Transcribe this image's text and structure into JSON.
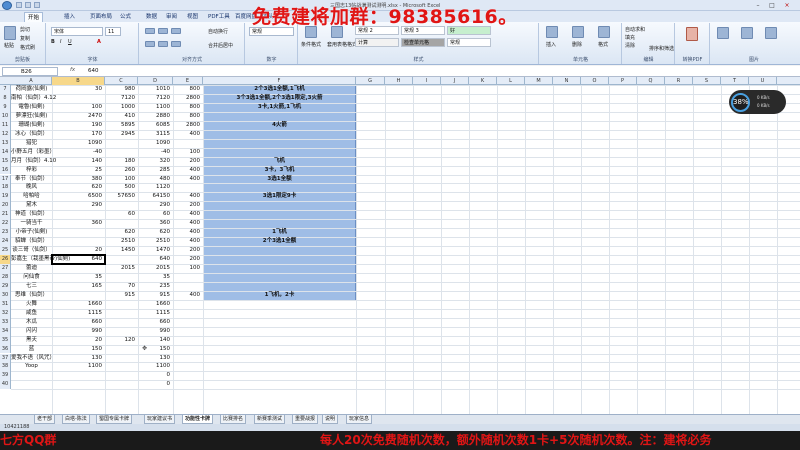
{
  "titlebar": {
    "title": "三国志13帖战满测试测明.xlsx - Microsoft Excel",
    "min": "–",
    "max": "□",
    "close": "×"
  },
  "tabs": [
    "开始",
    "插入",
    "页面布局",
    "公式",
    "数据",
    "审阅",
    "视图",
    "PDF工具",
    "百度网盘",
    "团队"
  ],
  "ribbon": {
    "clipboard": {
      "label": "剪贴板",
      "paste": "粘贴",
      "cut": "剪切",
      "copy": "复制",
      "format_painter": "格式刷"
    },
    "font": {
      "label": "字体",
      "name": "宋体",
      "size": "11"
    },
    "alignment": {
      "label": "对齐方式",
      "wrap": "自动换行",
      "merge": "合并后居中"
    },
    "number": {
      "label": "数字",
      "format": "常规"
    },
    "styles": {
      "label": "样式",
      "cond": "条件格式",
      "table": "套用表格格式",
      "cells": [
        {
          "text": "常规 2",
          "bg": "#ffffff"
        },
        {
          "text": "常规 3",
          "bg": "#ffffff"
        },
        {
          "text": "好",
          "bg": "#c6efce"
        },
        {
          "text": "计算",
          "bg": "#f2f2f2"
        },
        {
          "text": "检查单元格",
          "bg": "#a5a5a5"
        },
        {
          "text": "常规",
          "bg": "#ffffff"
        }
      ]
    },
    "cells": {
      "label": "单元格",
      "insert": "插入",
      "delete": "删除",
      "format": "格式"
    },
    "editing": {
      "label": "编辑",
      "autosum": "自动求和",
      "fill": "填充",
      "clear": "清除",
      "sort": "排序和筛选",
      "find": "查找和选择"
    },
    "pdf": {
      "label": "转换PDF"
    },
    "extra": {
      "label": "图片"
    }
  },
  "formula_bar": {
    "namebox": "B26",
    "fx": "fx",
    "value": "640"
  },
  "columns": [
    "A",
    "B",
    "C",
    "D",
    "E",
    "F",
    "G",
    "H",
    "I",
    "J",
    "K",
    "L",
    "M",
    "N",
    "O",
    "P",
    "Q",
    "R",
    "S",
    "T",
    "U"
  ],
  "rows": [
    {
      "n": "7",
      "a": "荷岡露(仙剣)",
      "b": "30",
      "c": "980",
      "d": "1010",
      "e": "800",
      "f": "2个3选1全额,1飞机"
    },
    {
      "n": "8",
      "a": "南帕（仙剑）4.12",
      "b": "",
      "c": "7120",
      "d": "7120",
      "e": "2800",
      "f": "3个3选1全额,2个3选1限定,3火箭"
    },
    {
      "n": "9",
      "a": "電魯(仙剣)",
      "b": "100",
      "c": "1000",
      "d": "1100",
      "e": "800",
      "f": "3卡,1火箭,1飞机"
    },
    {
      "n": "10",
      "a": "夢漂狂(仙剣)",
      "b": "2470",
      "c": "410",
      "d": "2880",
      "e": "800",
      "f": ""
    },
    {
      "n": "11",
      "a": "珊瑚(仙剣)",
      "b": "190",
      "c": "5895",
      "d": "6085",
      "e": "2800",
      "f": "4火箭"
    },
    {
      "n": "12",
      "a": "冰心（仙剑）",
      "b": "170",
      "c": "2945",
      "d": "3115",
      "e": "400",
      "f": ""
    },
    {
      "n": "13",
      "a": "猎犯",
      "b": "1090",
      "c": "",
      "d": "1090",
      "e": "",
      "f": ""
    },
    {
      "n": "14",
      "a": "小野五月（彩墨）",
      "b": "-40",
      "c": "",
      "d": "-40",
      "e": "100",
      "f": ""
    },
    {
      "n": "15",
      "a": "月月（仙剑）4.10",
      "b": "140",
      "c": "180",
      "d": "320",
      "e": "200",
      "f": "飞机"
    },
    {
      "n": "16",
      "a": "梓彩",
      "b": "25",
      "c": "260",
      "d": "285",
      "e": "400",
      "f": "3卡，3飞机"
    },
    {
      "n": "17",
      "a": "奉节（仙剑）",
      "b": "380",
      "c": "100",
      "d": "480",
      "e": "400",
      "f": "3选1全额"
    },
    {
      "n": "18",
      "a": "晚风",
      "b": "620",
      "c": "500",
      "d": "1120",
      "e": "",
      "f": ""
    },
    {
      "n": "19",
      "a": "哈帕哈",
      "b": "6500",
      "c": "57650",
      "d": "64150",
      "e": "400",
      "f": "3选1限定9卡"
    },
    {
      "n": "20",
      "a": "黛木",
      "b": "290",
      "c": "",
      "d": "290",
      "e": "200",
      "f": ""
    },
    {
      "n": "21",
      "a": "神道（仙剑）",
      "b": "",
      "c": "60",
      "d": "60",
      "e": "400",
      "f": ""
    },
    {
      "n": "22",
      "a": "一骑当千",
      "b": "360",
      "c": "",
      "d": "360",
      "e": "400",
      "f": ""
    },
    {
      "n": "23",
      "a": "小帝子(仙剣)",
      "b": "",
      "c": "620",
      "d": "620",
      "e": "400",
      "f": "1飞机"
    },
    {
      "n": "24",
      "a": "貂蝉（仙剑）",
      "b": "",
      "c": "2510",
      "d": "2510",
      "e": "400",
      "f": "2个3选1全额"
    },
    {
      "n": "25",
      "a": "谈三哥（仙剑）",
      "b": "20",
      "c": "1450",
      "d": "1470",
      "e": "200",
      "f": ""
    },
    {
      "n": "26",
      "a": "彭嘉生（栽墨黑帝)仙剣)",
      "b": "640",
      "c": "",
      "d": "640",
      "e": "200",
      "f": ""
    },
    {
      "n": "27",
      "a": "蕾迪",
      "b": "",
      "c": "2015",
      "d": "2015",
      "e": "100",
      "f": ""
    },
    {
      "n": "28",
      "a": "问仙食",
      "b": "35",
      "c": "",
      "d": "35",
      "e": "",
      "f": ""
    },
    {
      "n": "29",
      "a": "七三",
      "b": "165",
      "c": "70",
      "d": "235",
      "e": "",
      "f": ""
    },
    {
      "n": "30",
      "a": "思维（仙剑）",
      "b": "",
      "c": "915",
      "d": "915",
      "e": "400",
      "f": "1飞机，2卡"
    },
    {
      "n": "31",
      "a": "火舞",
      "b": "1660",
      "c": "",
      "d": "1660",
      "e": "",
      "f": ""
    },
    {
      "n": "32",
      "a": "咸鱼",
      "b": "1115",
      "c": "",
      "d": "1115",
      "e": "",
      "f": ""
    },
    {
      "n": "33",
      "a": "木瓜",
      "b": "660",
      "c": "",
      "d": "660",
      "e": "",
      "f": ""
    },
    {
      "n": "34",
      "a": "闪闪",
      "b": "990",
      "c": "",
      "d": "990",
      "e": "",
      "f": ""
    },
    {
      "n": "35",
      "a": "黑天",
      "b": "20",
      "c": "120",
      "d": "140",
      "e": "",
      "f": ""
    },
    {
      "n": "36",
      "a": "蓝",
      "b": "150",
      "c": "",
      "d": "150",
      "e": "",
      "f": ""
    },
    {
      "n": "37",
      "a": "爱我不语（风咒）",
      "b": "130",
      "c": "",
      "d": "130",
      "e": "",
      "f": ""
    },
    {
      "n": "38",
      "a": "Yoop",
      "b": "1100",
      "c": "",
      "d": "1100",
      "e": "",
      "f": ""
    },
    {
      "n": "39",
      "a": "",
      "b": "",
      "c": "",
      "d": "0",
      "e": "",
      "f": ""
    },
    {
      "n": "40",
      "a": "",
      "b": "",
      "c": "",
      "d": "0",
      "e": "",
      "f": ""
    }
  ],
  "sheets": [
    "老干部",
    "白塔-陈法",
    "蜀国专属卡牌",
    "玩家建议书",
    "功能性卡牌",
    "比赛排名",
    "新赛季测试",
    "重要战报",
    "说明",
    "玩家信息"
  ],
  "active_sheet": "功能性卡牌",
  "status": {
    "text": "10421188"
  },
  "overlay": {
    "text": "免费建将加群：98385616。"
  },
  "ticker": {
    "left": "七方QQ群",
    "right": "每人20次免费随机次数，额外随机次数1卡+5次随机次数。注：建将必务"
  },
  "badge": {
    "pct": "38%",
    "line1": "0 KB/s",
    "line2": "0 KB/s"
  },
  "colors": {
    "highlight": "#9fbde6",
    "selected_header": "#f7d88a",
    "overlay": "#e01515"
  }
}
